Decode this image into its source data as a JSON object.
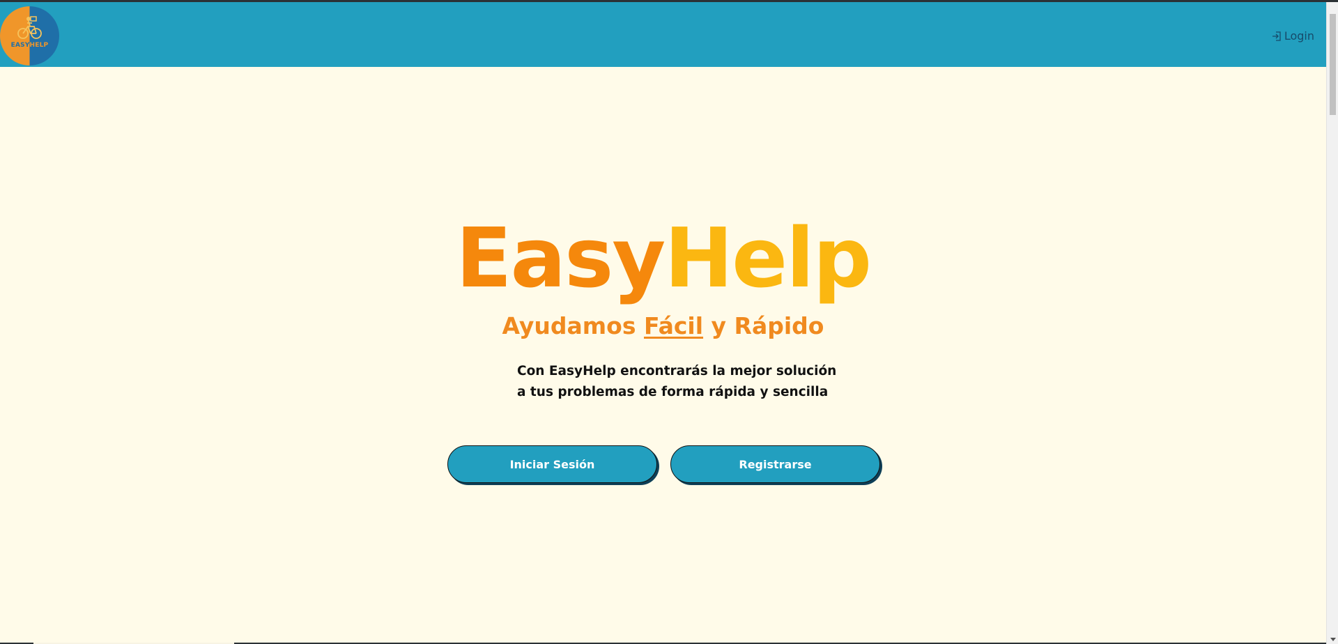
{
  "navbar": {
    "logo": {
      "word1": "EASY",
      "word2": "HELP",
      "icon": "bicycle-courier-icon"
    },
    "login_icon": "login-icon",
    "login_label": "Login"
  },
  "hero": {
    "title_part1": "Easy",
    "title_part2": "Help",
    "subtitle_part1": "Ayudamos ",
    "subtitle_underlined": "Fácil",
    "subtitle_part2": " y Rápido",
    "description_line1": "Con EasyHelp encontrarás la mejor solución",
    "description_line2": "a tus problemas de forma rápida y sencilla"
  },
  "buttons": {
    "login": "Iniciar Sesión",
    "register": "Registrarse"
  },
  "colors": {
    "navbar": "#229fbf",
    "page_background": "#fffbe9",
    "title_easy": "#f5880c",
    "title_help": "#fbb711",
    "subtitle": "#f08a1f",
    "button": "#229fbf"
  }
}
